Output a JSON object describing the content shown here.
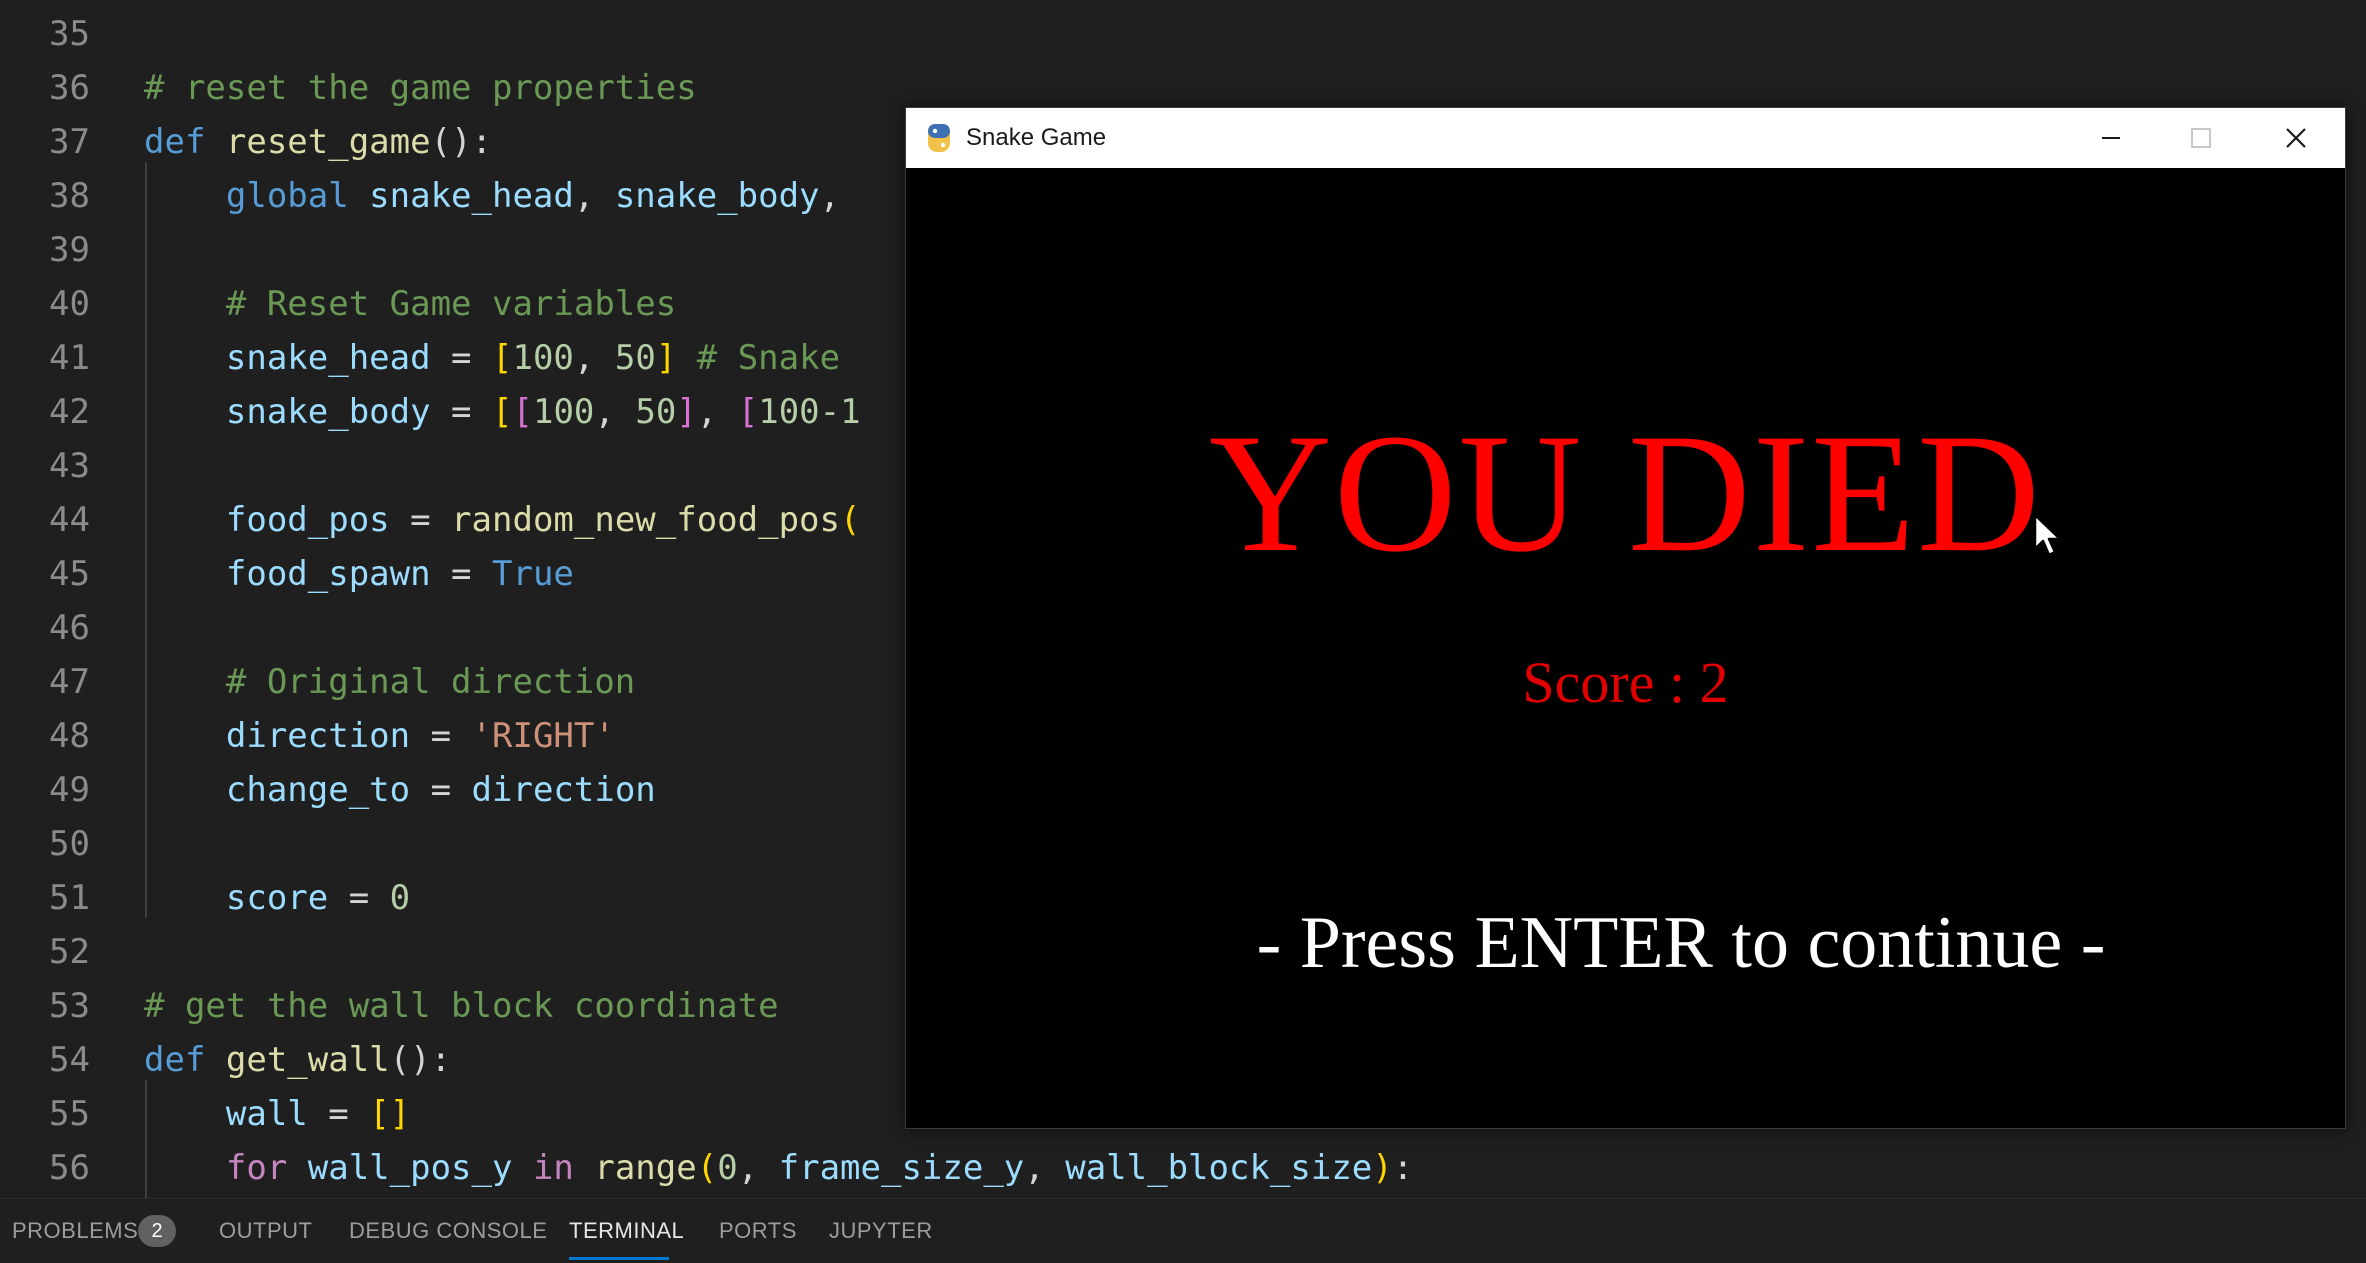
{
  "editor": {
    "lines": [
      {
        "num": "35",
        "tokens": []
      },
      {
        "num": "36",
        "tokens": [
          {
            "text": "# reset the game properties",
            "cls": "t-cm"
          }
        ]
      },
      {
        "num": "37",
        "tokens": [
          {
            "text": "def ",
            "cls": "t-kw"
          },
          {
            "text": "reset_game",
            "cls": "t-fn"
          },
          {
            "text": "():",
            "cls": "t-op"
          }
        ]
      },
      {
        "num": "38",
        "tokens": [
          {
            "text": "    global ",
            "cls": "t-kw"
          },
          {
            "text": "snake_head",
            "cls": "t-var"
          },
          {
            "text": ", ",
            "cls": "t-op"
          },
          {
            "text": "snake_body",
            "cls": "t-var"
          },
          {
            "text": ",",
            "cls": "t-op"
          }
        ]
      },
      {
        "num": "39",
        "tokens": []
      },
      {
        "num": "40",
        "tokens": [
          {
            "text": "    # Reset Game variables",
            "cls": "t-cm"
          }
        ]
      },
      {
        "num": "41",
        "tokens": [
          {
            "text": "    snake_head",
            "cls": "t-var"
          },
          {
            "text": " = ",
            "cls": "t-op"
          },
          {
            "text": "[",
            "cls": "t-br1"
          },
          {
            "text": "100",
            "cls": "t-num"
          },
          {
            "text": ", ",
            "cls": "t-op"
          },
          {
            "text": "50",
            "cls": "t-num"
          },
          {
            "text": "]",
            "cls": "t-br1"
          },
          {
            "text": " # Snake",
            "cls": "t-cm"
          }
        ]
      },
      {
        "num": "42",
        "tokens": [
          {
            "text": "    snake_body",
            "cls": "t-var"
          },
          {
            "text": " = ",
            "cls": "t-op"
          },
          {
            "text": "[",
            "cls": "t-br1"
          },
          {
            "text": "[",
            "cls": "t-br2"
          },
          {
            "text": "100",
            "cls": "t-num"
          },
          {
            "text": ", ",
            "cls": "t-op"
          },
          {
            "text": "50",
            "cls": "t-num"
          },
          {
            "text": "]",
            "cls": "t-br2"
          },
          {
            "text": ", ",
            "cls": "t-op"
          },
          {
            "text": "[",
            "cls": "t-br2"
          },
          {
            "text": "100",
            "cls": "t-num"
          },
          {
            "text": "-1",
            "cls": "t-num"
          }
        ]
      },
      {
        "num": "43",
        "tokens": []
      },
      {
        "num": "44",
        "tokens": [
          {
            "text": "    food_pos",
            "cls": "t-var"
          },
          {
            "text": " = ",
            "cls": "t-op"
          },
          {
            "text": "random_new_food_pos",
            "cls": "t-fn"
          },
          {
            "text": "(",
            "cls": "t-br1"
          }
        ]
      },
      {
        "num": "45",
        "tokens": [
          {
            "text": "    food_spawn",
            "cls": "t-var"
          },
          {
            "text": " = ",
            "cls": "t-op"
          },
          {
            "text": "True",
            "cls": "t-kw"
          }
        ]
      },
      {
        "num": "46",
        "tokens": []
      },
      {
        "num": "47",
        "tokens": [
          {
            "text": "    # Original direction",
            "cls": "t-cm"
          }
        ]
      },
      {
        "num": "48",
        "tokens": [
          {
            "text": "    direction",
            "cls": "t-var"
          },
          {
            "text": " = ",
            "cls": "t-op"
          },
          {
            "text": "'RIGHT'",
            "cls": "t-str"
          }
        ]
      },
      {
        "num": "49",
        "tokens": [
          {
            "text": "    change_to",
            "cls": "t-var"
          },
          {
            "text": " = ",
            "cls": "t-op"
          },
          {
            "text": "direction",
            "cls": "t-var"
          }
        ]
      },
      {
        "num": "50",
        "tokens": []
      },
      {
        "num": "51",
        "tokens": [
          {
            "text": "    score",
            "cls": "t-var"
          },
          {
            "text": " = ",
            "cls": "t-op"
          },
          {
            "text": "0",
            "cls": "t-num"
          }
        ]
      },
      {
        "num": "52",
        "tokens": []
      },
      {
        "num": "53",
        "tokens": [
          {
            "text": "# get the wall block coordinate",
            "cls": "t-cm"
          }
        ]
      },
      {
        "num": "54",
        "tokens": [
          {
            "text": "def ",
            "cls": "t-kw"
          },
          {
            "text": "get_wall",
            "cls": "t-fn"
          },
          {
            "text": "():",
            "cls": "t-op"
          }
        ]
      },
      {
        "num": "55",
        "tokens": [
          {
            "text": "    wall",
            "cls": "t-var"
          },
          {
            "text": " = ",
            "cls": "t-op"
          },
          {
            "text": "[]",
            "cls": "t-br1"
          }
        ]
      },
      {
        "num": "56",
        "tokens": [
          {
            "text": "    for ",
            "cls": "t-ctl"
          },
          {
            "text": "wall_pos_y",
            "cls": "t-var"
          },
          {
            "text": " in ",
            "cls": "t-ctl"
          },
          {
            "text": "range",
            "cls": "t-fn"
          },
          {
            "text": "(",
            "cls": "t-br1"
          },
          {
            "text": "0",
            "cls": "t-num"
          },
          {
            "text": ", ",
            "cls": "t-op"
          },
          {
            "text": "frame_size_y",
            "cls": "t-var"
          },
          {
            "text": ", ",
            "cls": "t-op"
          },
          {
            "text": "wall_block_size",
            "cls": "t-var"
          },
          {
            "text": ")",
            "cls": "t-br1"
          },
          {
            "text": ":",
            "cls": "t-op"
          }
        ]
      }
    ]
  },
  "game_window": {
    "title": "Snake Game",
    "headline": "YOU DIED",
    "score_text": "Score : 2",
    "prompt": "- Press ENTER to continue -"
  },
  "panel": {
    "tabs": [
      {
        "label": "PROBLEMS",
        "active": false,
        "badge": "2"
      },
      {
        "label": "OUTPUT",
        "active": false
      },
      {
        "label": "DEBUG CONSOLE",
        "active": false
      },
      {
        "label": "TERMINAL",
        "active": true
      },
      {
        "label": "PORTS",
        "active": false
      },
      {
        "label": "JUPYTER",
        "active": false
      }
    ]
  },
  "colors": {
    "editor_bg": "#1f1f1f",
    "headline": "#ff0000",
    "accent": "#0078d4"
  }
}
